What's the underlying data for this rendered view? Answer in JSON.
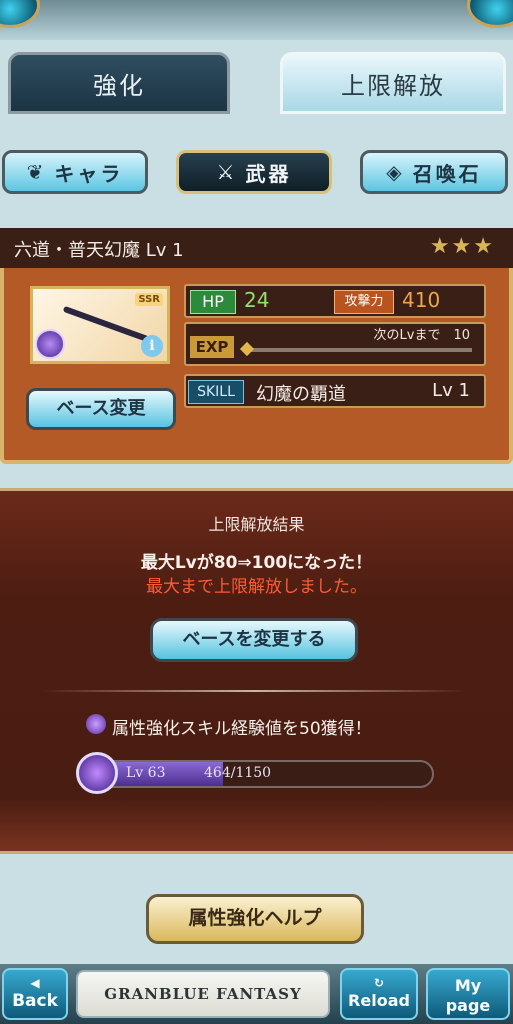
{
  "tabs": [
    {
      "label": "強化",
      "active": false
    },
    {
      "label": "上限解放",
      "active": true
    }
  ],
  "categories": [
    {
      "label": "キャラ",
      "icon": "chara-icon"
    },
    {
      "label": "武器",
      "icon": "crossed-swords-icon",
      "selected": true
    },
    {
      "label": "召喚石",
      "icon": "summon-crystal-icon"
    }
  ],
  "weapon": {
    "name_line": "六道・普天幻魔 Lv 1",
    "rarity_stars": "★★★",
    "rarity_badge": "SSR",
    "hp_label": "HP",
    "hp": "24",
    "atk_label": "攻撃力",
    "atk": "410",
    "exp_label": "EXP",
    "next_label": "次のLvまで　10",
    "exp_progress": 0.0,
    "skill_label": "SKILL",
    "skill_name": "幻魔の覇道",
    "skill_lv": "Lv 1",
    "base_change_label": "ベース変更",
    "info_glyph": "i"
  },
  "result": {
    "title": "上限解放結果",
    "line1": "最大Lvが80⇒100になった！",
    "line2": "最大まで上限解放しました。",
    "change_button": "ベースを変更する",
    "gain_text": "属性強化スキル経験値を50獲得！",
    "lv_label": "Lv 63",
    "lv_value": "464/1150",
    "lv_progress": 0.403
  },
  "help_button": "属性強化ヘルプ",
  "footer": {
    "back": "Back",
    "logo": "GRANBLUE FANTASY",
    "reload": "Reload",
    "mypage_line1": "My",
    "mypage_line2": "page"
  },
  "colors": {
    "panel": "#b45a26",
    "result_bg": "#4d1d12",
    "accent_gold": "#d8b46a",
    "highlight_red": "#ff5b35"
  }
}
